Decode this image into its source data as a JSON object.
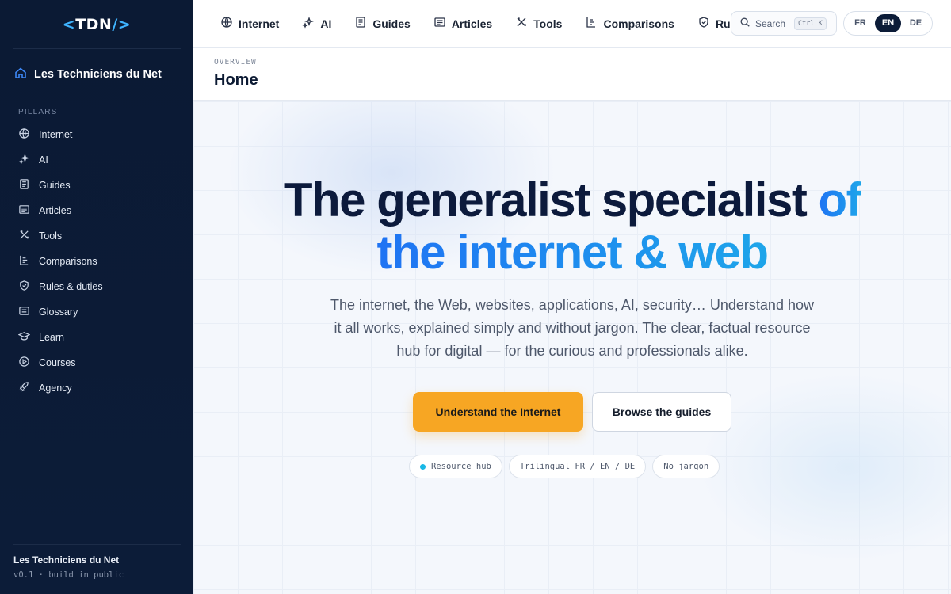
{
  "sidebar": {
    "logo": {
      "open": "<",
      "name": "TDN",
      "close": "/>"
    },
    "home_label": "Les Techniciens du Net",
    "section_label": "PILLARS",
    "items": [
      {
        "label": "Internet",
        "icon": "globe-icon"
      },
      {
        "label": "AI",
        "icon": "sparkle-icon"
      },
      {
        "label": "Guides",
        "icon": "document-icon"
      },
      {
        "label": "Articles",
        "icon": "newspaper-icon"
      },
      {
        "label": "Tools",
        "icon": "tools-icon"
      },
      {
        "label": "Comparisons",
        "icon": "comparison-icon"
      },
      {
        "label": "Rules & duties",
        "icon": "shield-icon"
      },
      {
        "label": "Glossary",
        "icon": "glossary-icon"
      },
      {
        "label": "Learn",
        "icon": "graduation-cap-icon"
      },
      {
        "label": "Courses",
        "icon": "play-circle-icon"
      },
      {
        "label": "Agency",
        "icon": "rocket-icon"
      }
    ],
    "footer_name": "Les Techniciens du Net",
    "footer_version": "v0.1 · build in public"
  },
  "topnav": {
    "items": [
      {
        "label": "Internet",
        "icon": "globe-icon"
      },
      {
        "label": "AI",
        "icon": "sparkle-icon"
      },
      {
        "label": "Guides",
        "icon": "document-icon"
      },
      {
        "label": "Articles",
        "icon": "newspaper-icon"
      },
      {
        "label": "Tools",
        "icon": "tools-icon"
      },
      {
        "label": "Comparisons",
        "icon": "comparison-icon"
      },
      {
        "label": "Rule",
        "icon": "shield-icon"
      }
    ],
    "search_placeholder": "Search",
    "search_shortcut": "Ctrl K",
    "languages": [
      "FR",
      "EN",
      "DE"
    ],
    "active_language": "EN"
  },
  "page": {
    "breadcrumb": "OVERVIEW",
    "title": "Home"
  },
  "hero": {
    "headline_main": "The generalist specialist ",
    "headline_accent_1": "of",
    "headline_accent_2": "the internet & web",
    "subtitle": "The internet, the Web, websites, applications, AI, security… Understand how it all works, explained simply and without jargon. The clear, factual resource hub for digital — for the curious and professionals alike.",
    "primary_cta": "Understand the Internet",
    "secondary_cta": "Browse the guides",
    "chips": [
      "Resource hub",
      "Trilingual FR / EN / DE",
      "No jargon"
    ]
  },
  "colors": {
    "sidebar_bg": "#0c1c38",
    "accent_blue": "#1f73f3",
    "cta_orange": "#f7a623",
    "chip_dot": "#19b8e6"
  }
}
